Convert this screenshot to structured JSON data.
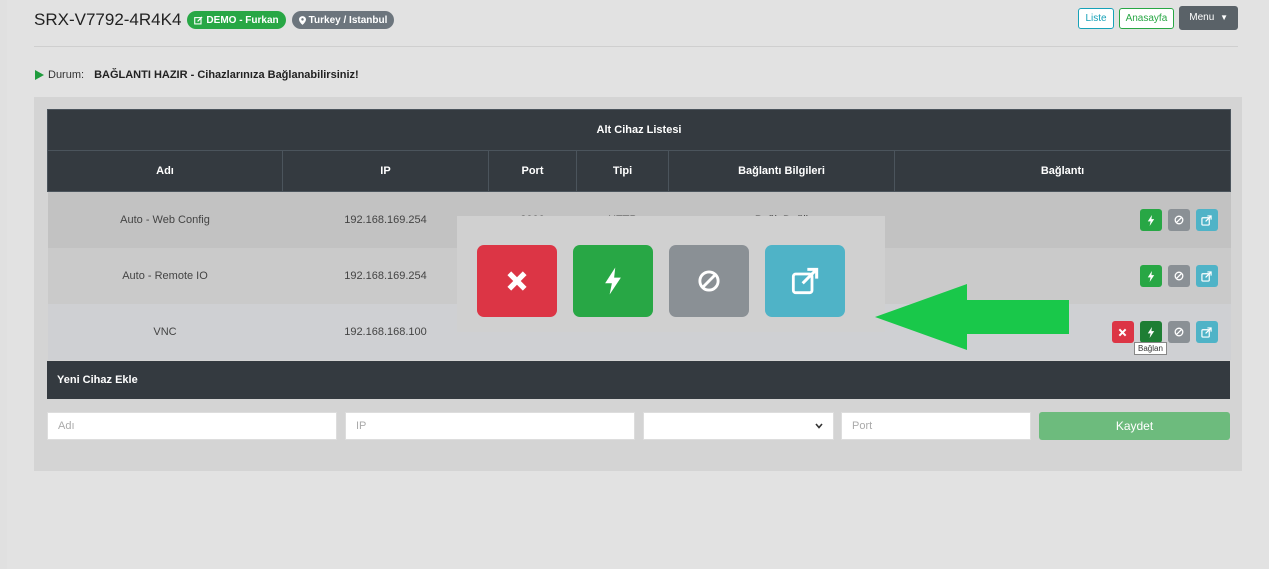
{
  "header": {
    "device_id": "SRX-V7792-4R4K4",
    "badge_demo": "DEMO - Furkan",
    "badge_location": "Turkey / Istanbul",
    "nav": {
      "list": "Liste",
      "home": "Anasayfa",
      "menu": "Menu"
    }
  },
  "status": {
    "label": "Durum:",
    "message": "BAĞLANTI HAZIR - Cihazlarınıza Bağlanabilirsiniz!"
  },
  "table": {
    "title": "Alt Cihaz Listesi",
    "columns": [
      "Adı",
      "IP",
      "Port",
      "Tipi",
      "Bağlantı Bilgileri",
      "Bağlantı"
    ],
    "rows": [
      {
        "name": "Auto - Web Config",
        "ip": "192.168.169.254",
        "port": "3000",
        "type": "HTTP",
        "info": "Bağlı Değil"
      },
      {
        "name": "Auto - Remote IO",
        "ip": "192.168.169.254",
        "port": "",
        "type": "",
        "info": ""
      },
      {
        "name": "VNC",
        "ip": "192.168.168.100",
        "port": "",
        "type": "",
        "info": ""
      }
    ]
  },
  "tooltip": "Bağlan",
  "new_device": {
    "title": "Yeni Cihaz Ekle",
    "name_placeholder": "Adı",
    "ip_placeholder": "IP",
    "type_value": "",
    "port_placeholder": "Port",
    "save_label": "Kaydet"
  },
  "icons": {
    "delete": "times-icon",
    "connect": "bolt-icon",
    "disconnect": "ban-icon",
    "open": "external-link-icon",
    "status": "play-icon",
    "arrow": "left-arrow-icon"
  },
  "colors": {
    "danger": "#dc3545",
    "success": "#28a745",
    "secondary": "#8a9095",
    "info": "#4fb3c7",
    "dark": "#343a40",
    "arrow": "#19c84a"
  }
}
